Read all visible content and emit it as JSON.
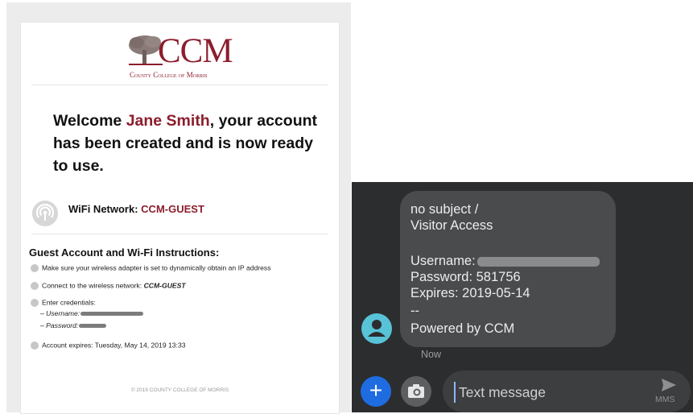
{
  "email": {
    "logo_text": "CCM",
    "logo_subtitle": "County College of Morris",
    "welcome_prefix": "Welcome ",
    "user_name": "Jane Smith",
    "welcome_suffix": ", your account has been created and is now ready to use.",
    "wifi_label": "WiFi Network: ",
    "wifi_name": "CCM-GUEST",
    "instructions_title": "Guest Account and Wi-Fi Instructions:",
    "steps": [
      "Make sure your wireless adapter is set to dynamically obtain an IP address",
      "Connect to the wireless network: ",
      "Enter credentials:",
      "Account expires: Tuesday, May 14, 2019 13:33"
    ],
    "step2_network": "CCM-GUEST",
    "username_label": "– Username:",
    "password_label": "– Password:",
    "footer": "© 2019 COUNTY COLLEGE OF MORRIS",
    "accent_color": "#8c1d2d"
  },
  "sms": {
    "lines": [
      "no subject /",
      "Visitor Access",
      "Username:",
      "Password: 581756",
      "Expires: 2019-05-14",
      "--",
      "Powered by CCM"
    ],
    "timestamp": "Now",
    "compose_placeholder": "Text message",
    "send_label": "MMS",
    "icons": {
      "contact": "person-icon",
      "add": "plus-icon",
      "attach": "camera-icon",
      "send": "send-arrow-icon"
    },
    "colors": {
      "background": "#2c2d2f",
      "bubble": "#4a4b4d",
      "avatar": "#58c2d6",
      "add_button": "#1e6ce0"
    }
  }
}
